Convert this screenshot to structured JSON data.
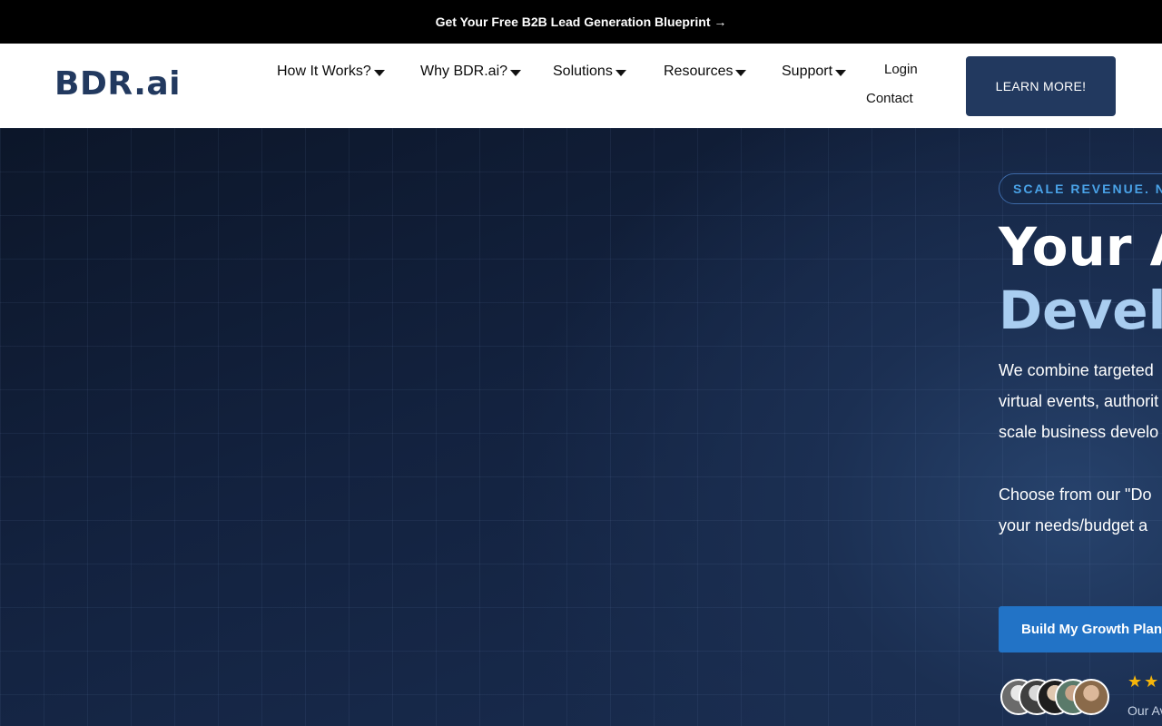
{
  "topbar": {
    "text": "Get Your Free B2B Lead Generation Blueprint →"
  },
  "header": {
    "logo": "BDR.ai",
    "nav": [
      {
        "label": "How It Works?"
      },
      {
        "label": "Why BDR.ai?"
      },
      {
        "label": "Solutions"
      },
      {
        "label": "Resources"
      },
      {
        "label": "Support"
      }
    ],
    "login": "Login",
    "contact": "Contact",
    "cta": "LEARN MORE!"
  },
  "hero": {
    "eyebrow": "SCALE REVENUE. NO",
    "headline_line1": "Your A",
    "headline_line2": "Develo",
    "para1": [
      "We combine targeted",
      "virtual events, authorit",
      "scale business develo"
    ],
    "para2": [
      "Choose from our \"Do",
      "your needs/budget a"
    ],
    "button": "Build My Growth Plan",
    "stars": "★★",
    "rating_text": "Our Av"
  },
  "colors": {
    "brand": "#22395f",
    "accent": "#2273c6",
    "highlight": "#a9cdf0",
    "star": "#f5b50a"
  }
}
